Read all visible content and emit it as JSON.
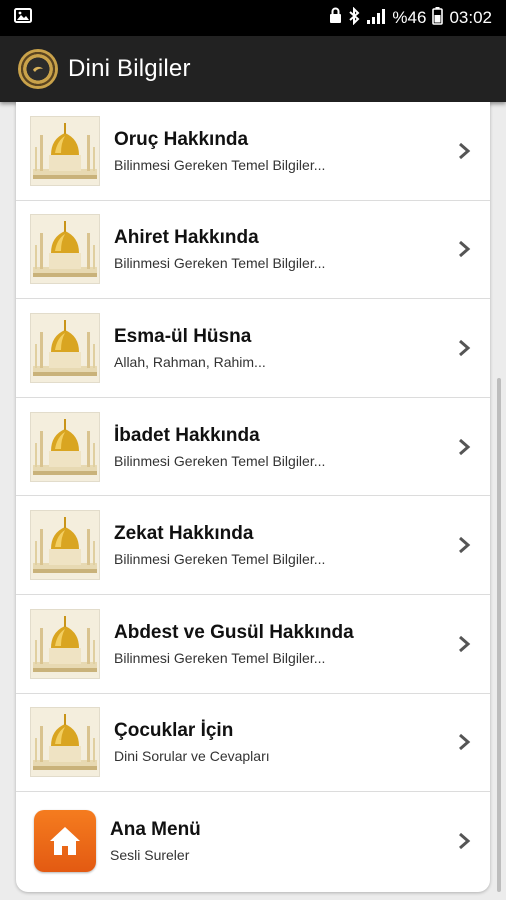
{
  "status_bar": {
    "battery_percent": "%46",
    "time": "03:02",
    "icons": [
      "image-icon",
      "lock-icon",
      "bluetooth-icon",
      "signal-icon",
      "battery-icon"
    ]
  },
  "app_bar": {
    "title": "Dini Bilgiler",
    "logo_icon": "app-logo-icon"
  },
  "list": [
    {
      "title": "Oruç Hakkında",
      "subtitle": "Bilinmesi Gereken Temel Bilgiler...",
      "icon": "mosque-icon"
    },
    {
      "title": "Ahiret Hakkında",
      "subtitle": "Bilinmesi Gereken Temel Bilgiler...",
      "icon": "mosque-icon"
    },
    {
      "title": "Esma-ül Hüsna",
      "subtitle": "Allah, Rahman, Rahim...",
      "icon": "mosque-icon"
    },
    {
      "title": "İbadet Hakkında",
      "subtitle": "Bilinmesi Gereken Temel Bilgiler...",
      "icon": "mosque-icon"
    },
    {
      "title": "Zekat Hakkında",
      "subtitle": "Bilinmesi Gereken Temel Bilgiler...",
      "icon": "mosque-icon"
    },
    {
      "title": "Abdest ve Gusül Hakkında",
      "subtitle": "Bilinmesi Gereken Temel Bilgiler...",
      "icon": "mosque-icon"
    },
    {
      "title": "Çocuklar İçin",
      "subtitle": "Dini Sorular ve Cevapları",
      "icon": "mosque-icon"
    },
    {
      "title": "Ana Menü",
      "subtitle": "Sesli Sureler",
      "icon": "home-icon"
    }
  ],
  "colors": {
    "app_bar": "#222222",
    "status_bar": "#000000",
    "home_orange": "#f26d1c",
    "dome_gold": "#d9a521"
  }
}
